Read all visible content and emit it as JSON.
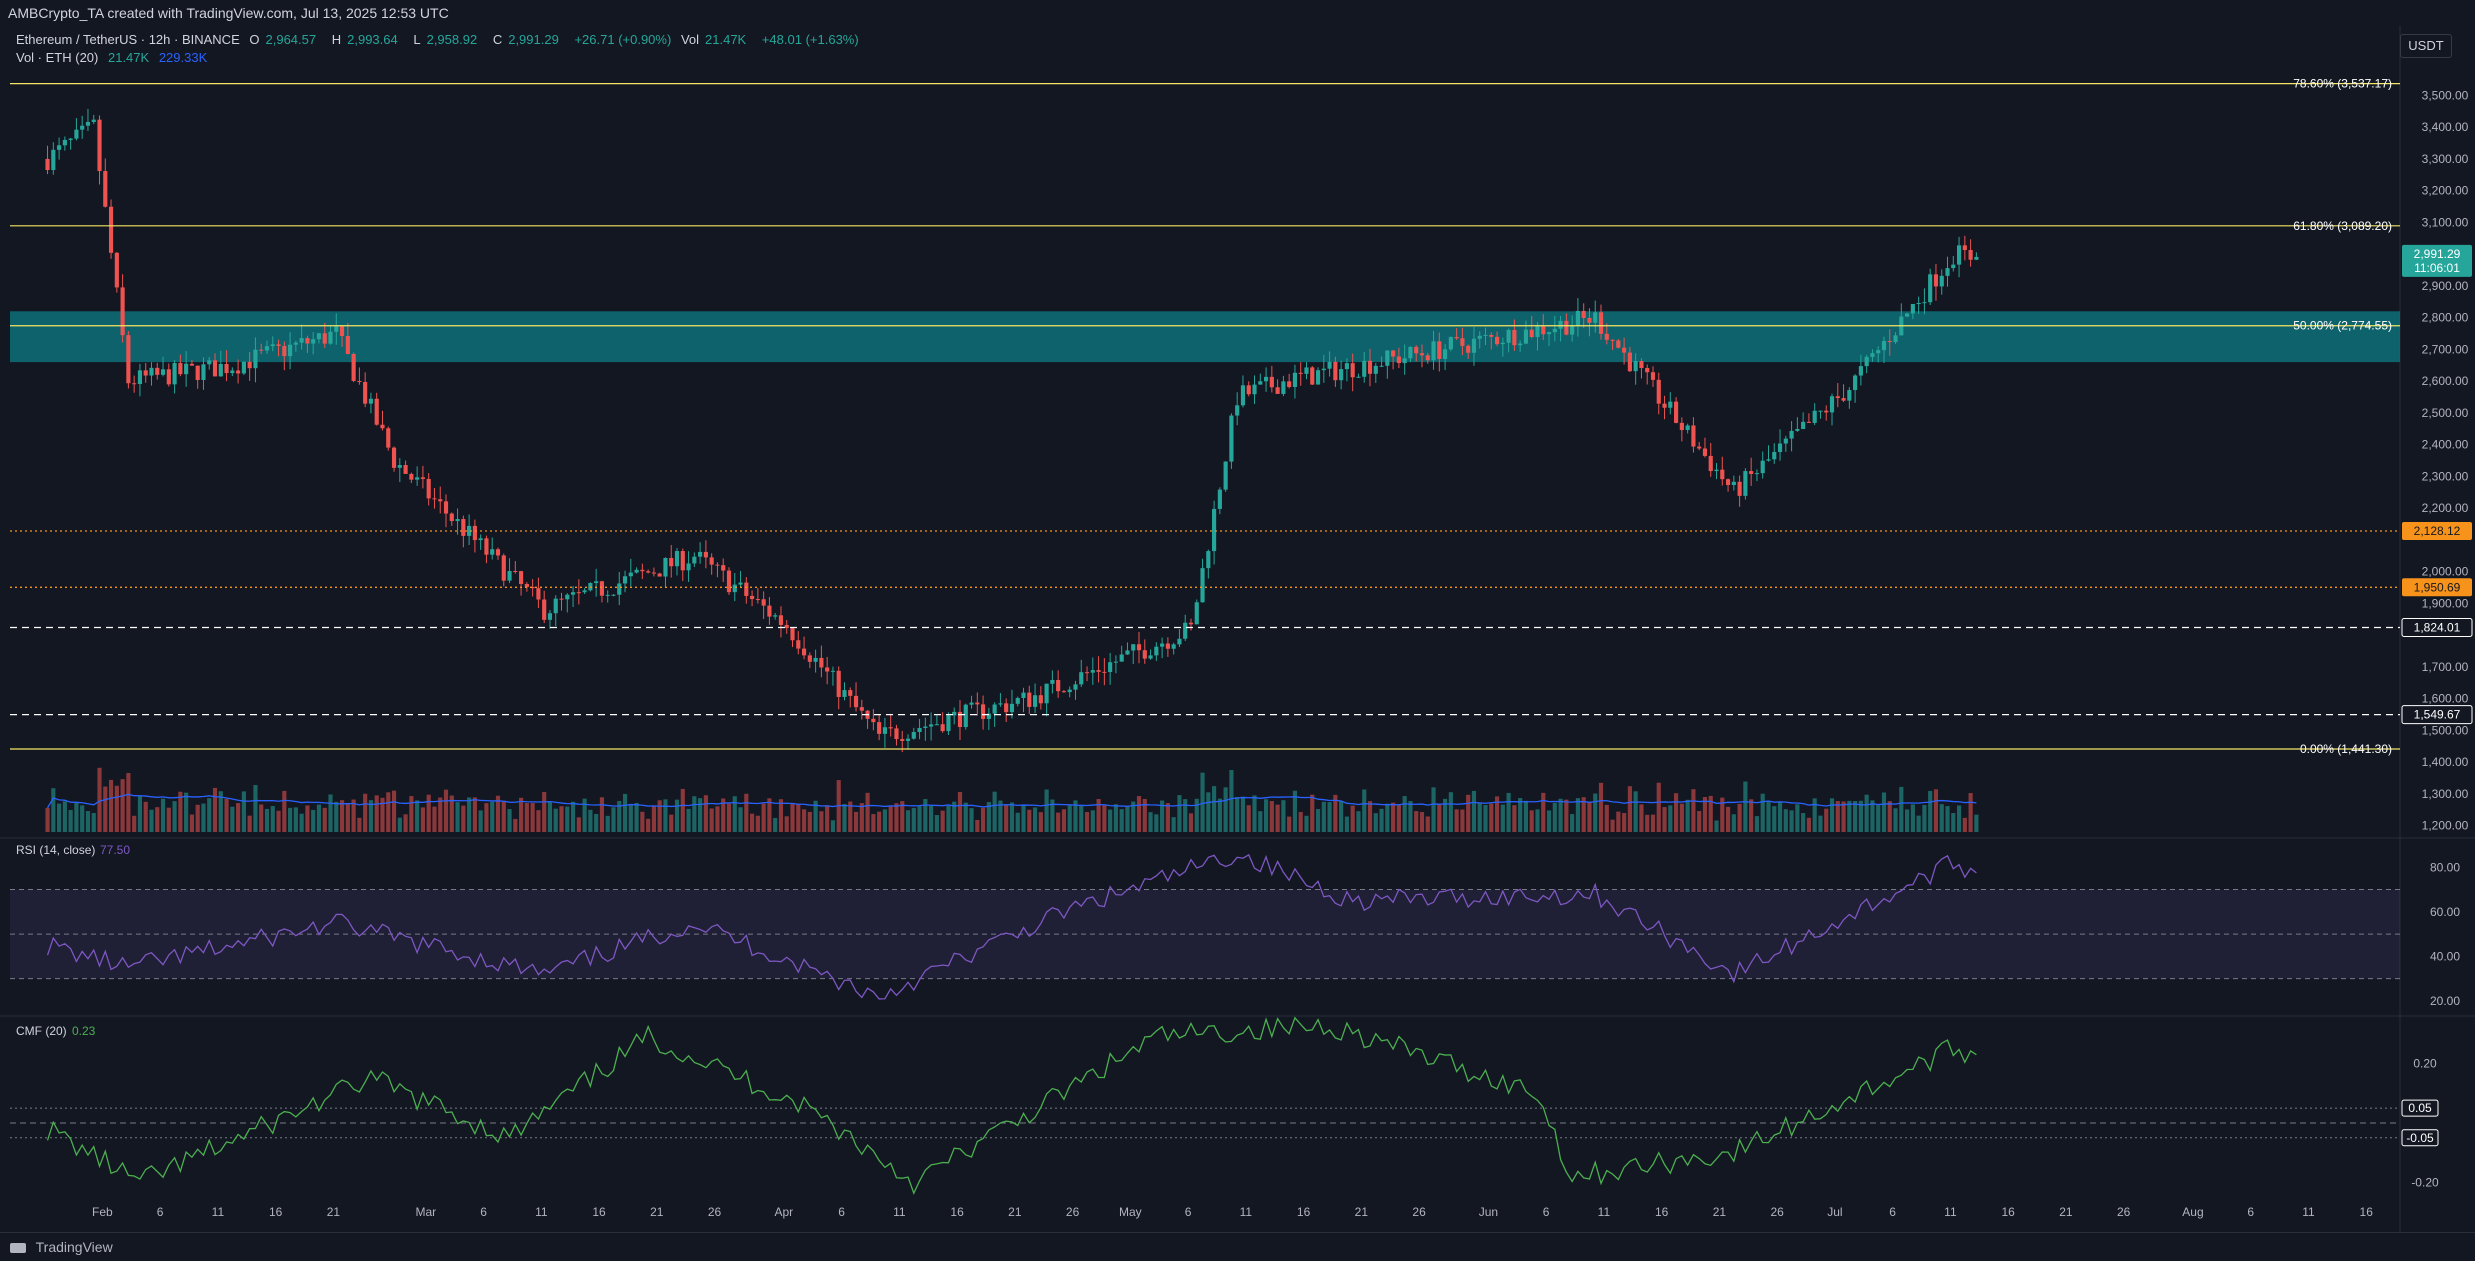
{
  "header": {
    "attribution": "AMBCrypto_TA created with TradingView.com, Jul 13, 2025 12:53 UTC"
  },
  "legend": {
    "symbol": "Ethereum / TetherUS · 12h · BINANCE",
    "open_label": "O",
    "open": "2,964.57",
    "high_label": "H",
    "high": "2,993.64",
    "low_label": "L",
    "low": "2,958.92",
    "close_label": "C",
    "close": "2,991.29",
    "change": "+26.71 (+0.90%)",
    "vol_label": "Vol",
    "vol": "21.47K",
    "vol2": "+48.01 (+1.63%)",
    "vol_ind_label": "Vol · ETH (20)",
    "vol_ind_v1": "21.47K",
    "vol_ind_v2": "229.33K"
  },
  "currency_button": "USDT",
  "footer": {
    "brand": "TradingView"
  },
  "colors": {
    "background": "#131722",
    "up": "#26a69a",
    "down": "#ef5350",
    "fib": "#f5e663",
    "zone": "#0e7c86",
    "rsi": "#7e57c2",
    "cmf": "#4caf50",
    "vol_ma": "#2962ff"
  },
  "chart_data": [
    {
      "type": "candlestick",
      "panel": "price",
      "y_axis_ticks": [
        "3,500.00",
        "3,400.00",
        "3,300.00",
        "3,200.00",
        "3,100.00",
        "3,000.00",
        "2,900.00",
        "2,800.00",
        "2,700.00",
        "2,600.00",
        "2,500.00",
        "2,400.00",
        "2,300.00",
        "2,200.00",
        "2,000.00",
        "1,900.00",
        "1,700.00",
        "1,600.00",
        "1,500.00",
        "1,400.00",
        "1,300.00",
        "1,200.00"
      ],
      "x_axis_ticks": [
        "Feb",
        "6",
        "11",
        "16",
        "21",
        "Mar",
        "6",
        "11",
        "16",
        "21",
        "26",
        "Apr",
        "6",
        "11",
        "16",
        "21",
        "26",
        "May",
        "6",
        "11",
        "16",
        "21",
        "26",
        "Jun",
        "6",
        "11",
        "16",
        "21",
        "26",
        "Jul",
        "6",
        "11",
        "16",
        "21",
        "26",
        "Aug",
        "6",
        "11",
        "16"
      ],
      "ylim": [
        1180,
        3580
      ],
      "candles_summary": "12h ETH/USDT Jan 27 to Jul 13, 2025",
      "key_points": [
        {
          "date": "2025-01-27",
          "price": 3300
        },
        {
          "date": "2025-01-31",
          "price": 3400
        },
        {
          "date": "2025-02-03",
          "price": 2600
        },
        {
          "date": "2025-02-12",
          "price": 2650
        },
        {
          "date": "2025-02-21",
          "price": 2750
        },
        {
          "date": "2025-02-26",
          "price": 2350
        },
        {
          "date": "2025-03-11",
          "price": 1880
        },
        {
          "date": "2025-03-24",
          "price": 2050
        },
        {
          "date": "2025-04-01",
          "price": 1830
        },
        {
          "date": "2025-04-09",
          "price": 1480
        },
        {
          "date": "2025-04-22",
          "price": 1600
        },
        {
          "date": "2025-05-06",
          "price": 1820
        },
        {
          "date": "2025-05-10",
          "price": 2550
        },
        {
          "date": "2025-05-14",
          "price": 2600
        },
        {
          "date": "2025-06-10",
          "price": 2800
        },
        {
          "date": "2025-06-22",
          "price": 2250
        },
        {
          "date": "2025-07-02",
          "price": 2580
        },
        {
          "date": "2025-07-11",
          "price": 3000
        },
        {
          "date": "2025-07-13",
          "price": 2991.29
        }
      ],
      "current_price": {
        "value": "2,991.29",
        "countdown": "11:06:01"
      },
      "fib_levels": [
        {
          "label": "78.60% (3,537.17)",
          "value": 3537.17
        },
        {
          "label": "61.80% (3,089.20)",
          "value": 3089.2
        },
        {
          "label": "50.00% (2,774.55)",
          "value": 2774.55
        },
        {
          "label": "0.00% (1,441.30)",
          "value": 1441.3
        }
      ],
      "zone": {
        "low": 2660,
        "high": 2820
      },
      "levels": [
        {
          "label": "2,128.12",
          "value": 2128.12,
          "style": "dotted",
          "color": "#f7931a"
        },
        {
          "label": "1,950.69",
          "value": 1950.69,
          "style": "dotted",
          "color": "#f7931a"
        },
        {
          "label": "1,824.01",
          "value": 1824.01,
          "style": "dashed",
          "color": "#ffffff"
        },
        {
          "label": "1,549.67",
          "value": 1549.67,
          "style": "dashed",
          "color": "#ffffff"
        }
      ]
    },
    {
      "type": "line",
      "panel": "rsi",
      "name": "RSI (14, close)",
      "current": "77.50",
      "y_axis_ticks": [
        "80.00",
        "60.00",
        "40.00",
        "20.00"
      ],
      "ylim": [
        15,
        90
      ],
      "bands": [
        70,
        50,
        30
      ],
      "key_points": [
        {
          "date": "2025-01-27",
          "value": 45
        },
        {
          "date": "2025-02-03",
          "value": 35
        },
        {
          "date": "2025-02-21",
          "value": 55
        },
        {
          "date": "2025-03-11",
          "value": 32
        },
        {
          "date": "2025-03-24",
          "value": 55
        },
        {
          "date": "2025-04-09",
          "value": 22
        },
        {
          "date": "2025-04-25",
          "value": 60
        },
        {
          "date": "2025-05-10",
          "value": 86
        },
        {
          "date": "2025-05-20",
          "value": 65
        },
        {
          "date": "2025-06-10",
          "value": 68
        },
        {
          "date": "2025-06-22",
          "value": 32
        },
        {
          "date": "2025-07-11",
          "value": 82
        },
        {
          "date": "2025-07-13",
          "value": 77.5
        }
      ]
    },
    {
      "type": "line",
      "panel": "cmf",
      "name": "CMF (20)",
      "current": "0.23",
      "y_axis_ticks": [
        "0.20",
        "0.05",
        "-0.05",
        "-0.20"
      ],
      "ylim": [
        -0.3,
        0.34
      ],
      "bands": [
        0.05,
        0,
        -0.05
      ],
      "key_points": [
        {
          "date": "2025-01-27",
          "value": -0.02
        },
        {
          "date": "2025-02-04",
          "value": -0.2
        },
        {
          "date": "2025-02-24",
          "value": 0.15
        },
        {
          "date": "2025-03-08",
          "value": -0.05
        },
        {
          "date": "2025-03-20",
          "value": 0.29
        },
        {
          "date": "2025-04-03",
          "value": 0.05
        },
        {
          "date": "2025-04-12",
          "value": -0.2
        },
        {
          "date": "2025-05-03",
          "value": 0.29
        },
        {
          "date": "2025-05-18",
          "value": 0.33
        },
        {
          "date": "2025-06-05",
          "value": 0.1
        },
        {
          "date": "2025-06-08",
          "value": -0.18
        },
        {
          "date": "2025-06-22",
          "value": -0.1
        },
        {
          "date": "2025-07-11",
          "value": 0.25
        },
        {
          "date": "2025-07-13",
          "value": 0.23
        }
      ]
    }
  ]
}
